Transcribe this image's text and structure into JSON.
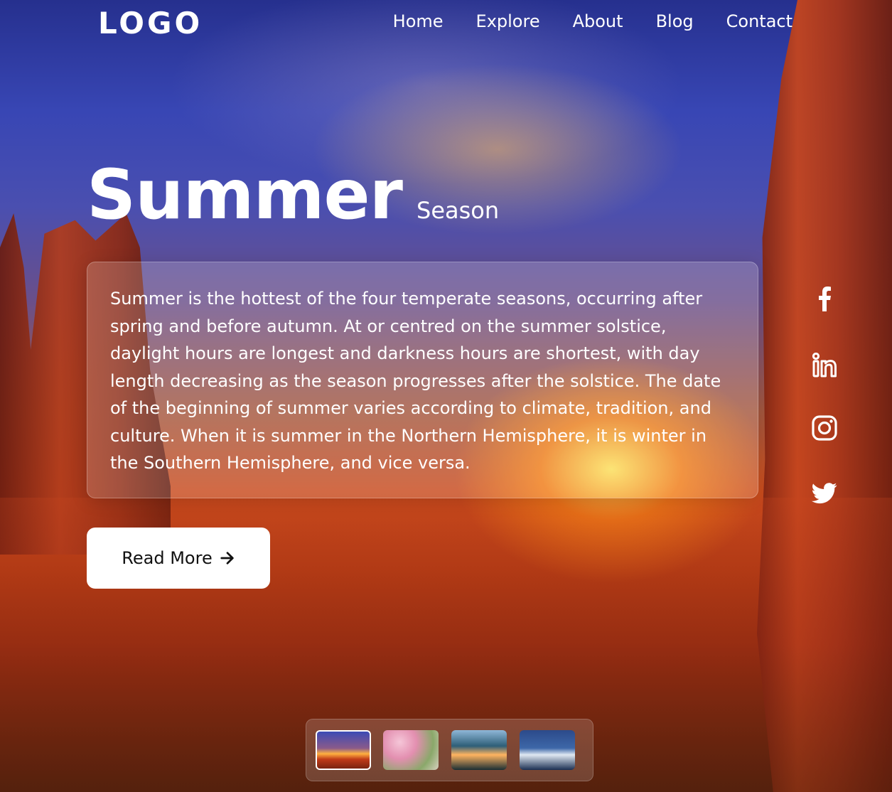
{
  "header": {
    "logo": "LOGO",
    "nav": [
      {
        "label": "Home"
      },
      {
        "label": "Explore"
      },
      {
        "label": "About"
      },
      {
        "label": "Blog"
      },
      {
        "label": "Contact"
      }
    ]
  },
  "hero": {
    "title": "Summer",
    "subtitle": "Season",
    "description": "Summer is the hottest of the four temperate seasons, occurring after spring and before autumn. At or centred on the summer solstice, daylight hours are longest and darkness hours are shortest, with day length decreasing as the season progresses after the solstice. The date of the beginning of summer varies according to climate, tradition, and culture. When it is summer in the Northern Hemisphere, it is winter in the Southern Hemisphere, and vice versa.",
    "button_label": "Read More"
  },
  "social": [
    {
      "icon": "facebook-icon"
    },
    {
      "icon": "linkedin-icon"
    },
    {
      "icon": "instagram-icon"
    },
    {
      "icon": "twitter-icon"
    }
  ],
  "thumbnails": [
    {
      "name": "summer-thumbnail",
      "active": true
    },
    {
      "name": "spring-thumbnail",
      "active": false
    },
    {
      "name": "autumn-thumbnail",
      "active": false
    },
    {
      "name": "winter-thumbnail",
      "active": false
    }
  ],
  "colors": {
    "text": "#ffffff",
    "button_bg": "#ffffff",
    "button_text": "#111111"
  }
}
